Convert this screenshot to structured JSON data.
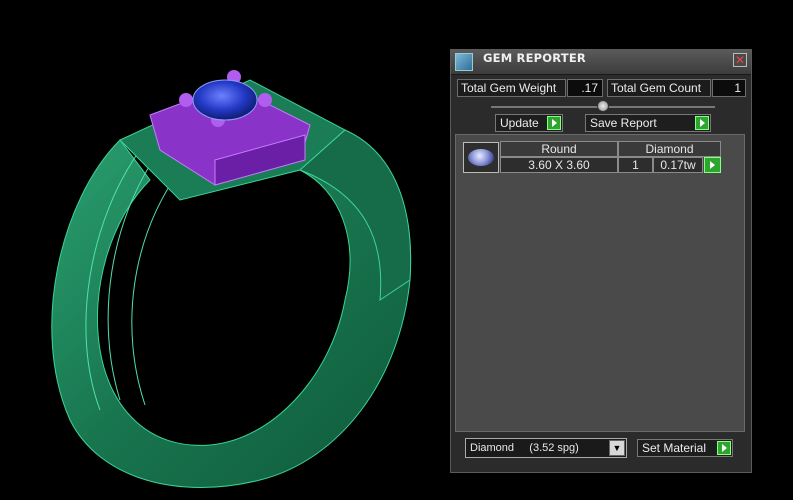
{
  "panel": {
    "title": "GEM REPORTER",
    "total_weight_label": "Total Gem Weight",
    "total_weight_value": ".17",
    "total_count_label": "Total Gem Count",
    "total_count_value": "1",
    "update_label": "Update",
    "save_report_label": "Save Report",
    "gem_table": {
      "headers": [
        "Round",
        "Diamond"
      ],
      "rows": [
        {
          "size": "3.60 X 3.60",
          "count": "1",
          "weight": "0.17tw"
        }
      ]
    },
    "material_select_value": "Diamond     (3.52 spg)",
    "set_material_label": "Set Material",
    "close_glyph": "✕"
  },
  "colors": {
    "ring_metal": "#1f8a5e",
    "setting": "#9b3fd6",
    "stone": "#2a3fc8",
    "background": "#000000"
  }
}
